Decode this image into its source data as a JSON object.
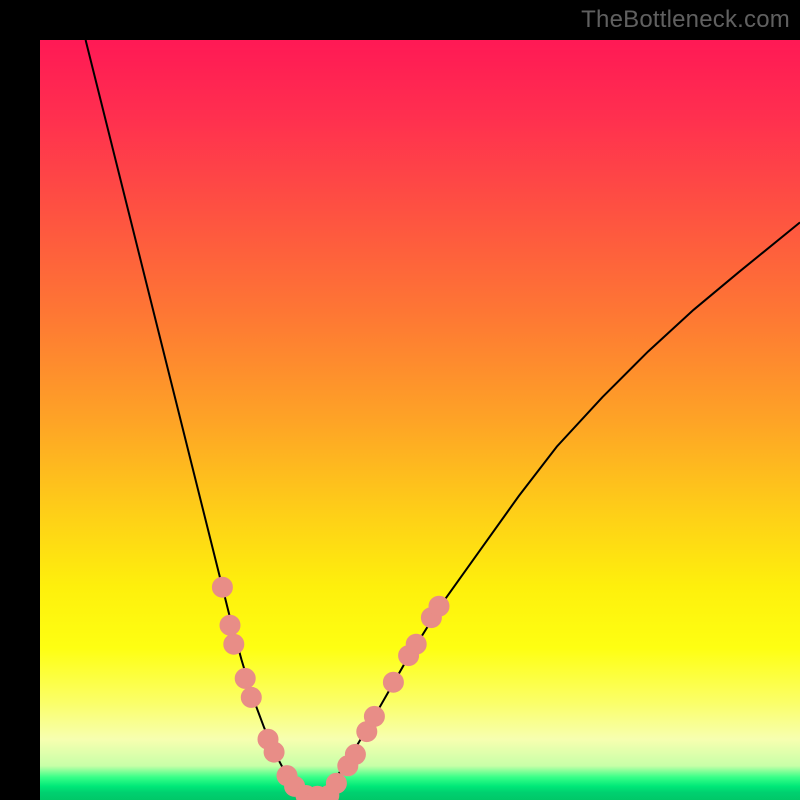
{
  "watermark": "TheBottleneck.com",
  "colors": {
    "curve_stroke": "#000000",
    "marker_fill": "#e88d87",
    "marker_stroke": "#e88d87",
    "background_black": "#000000"
  },
  "chart_data": {
    "type": "line",
    "title": "",
    "xlabel": "",
    "ylabel": "",
    "xlim": [
      0,
      100
    ],
    "ylim": [
      0,
      100
    ],
    "grid": false,
    "legend": false,
    "note": "Values are estimated from the pixel positions; no numeric axis labels are present in the image.",
    "series": [
      {
        "name": "left-curve",
        "x": [
          6,
          8,
          10,
          12,
          14,
          16,
          18,
          20,
          22,
          23.5,
          25,
          26.5,
          28,
          29.5,
          31,
          32.5,
          33.5,
          34.3,
          35,
          35.7
        ],
        "y": [
          100,
          92,
          84,
          76,
          68,
          60,
          52,
          44,
          36,
          30,
          24,
          18.5,
          13.5,
          9.5,
          6,
          3.2,
          1.6,
          0.7,
          0.2,
          0.05
        ]
      },
      {
        "name": "right-curve",
        "x": [
          35.7,
          36.5,
          37.5,
          39,
          41,
          44,
          48,
          53,
          58,
          63,
          68,
          74,
          80,
          86,
          92,
          100
        ],
        "y": [
          0.05,
          0.3,
          1.2,
          3,
          6,
          11,
          18,
          26,
          33,
          40,
          46.5,
          53,
          59,
          64.5,
          69.5,
          76
        ]
      }
    ],
    "markers": [
      {
        "x": 24.0,
        "y": 28.0
      },
      {
        "x": 25.0,
        "y": 23.0
      },
      {
        "x": 25.5,
        "y": 20.5
      },
      {
        "x": 27.0,
        "y": 16.0
      },
      {
        "x": 27.8,
        "y": 13.5
      },
      {
        "x": 30.0,
        "y": 8.0
      },
      {
        "x": 30.8,
        "y": 6.3
      },
      {
        "x": 32.5,
        "y": 3.2
      },
      {
        "x": 33.5,
        "y": 1.8
      },
      {
        "x": 35.0,
        "y": 0.6
      },
      {
        "x": 36.5,
        "y": 0.5
      },
      {
        "x": 38.0,
        "y": 0.6
      },
      {
        "x": 39.0,
        "y": 2.2
      },
      {
        "x": 40.5,
        "y": 4.5
      },
      {
        "x": 41.5,
        "y": 6.0
      },
      {
        "x": 43.0,
        "y": 9.0
      },
      {
        "x": 44.0,
        "y": 11.0
      },
      {
        "x": 46.5,
        "y": 15.5
      },
      {
        "x": 48.5,
        "y": 19.0
      },
      {
        "x": 49.5,
        "y": 20.5
      },
      {
        "x": 51.5,
        "y": 24.0
      },
      {
        "x": 52.5,
        "y": 25.5
      }
    ]
  }
}
